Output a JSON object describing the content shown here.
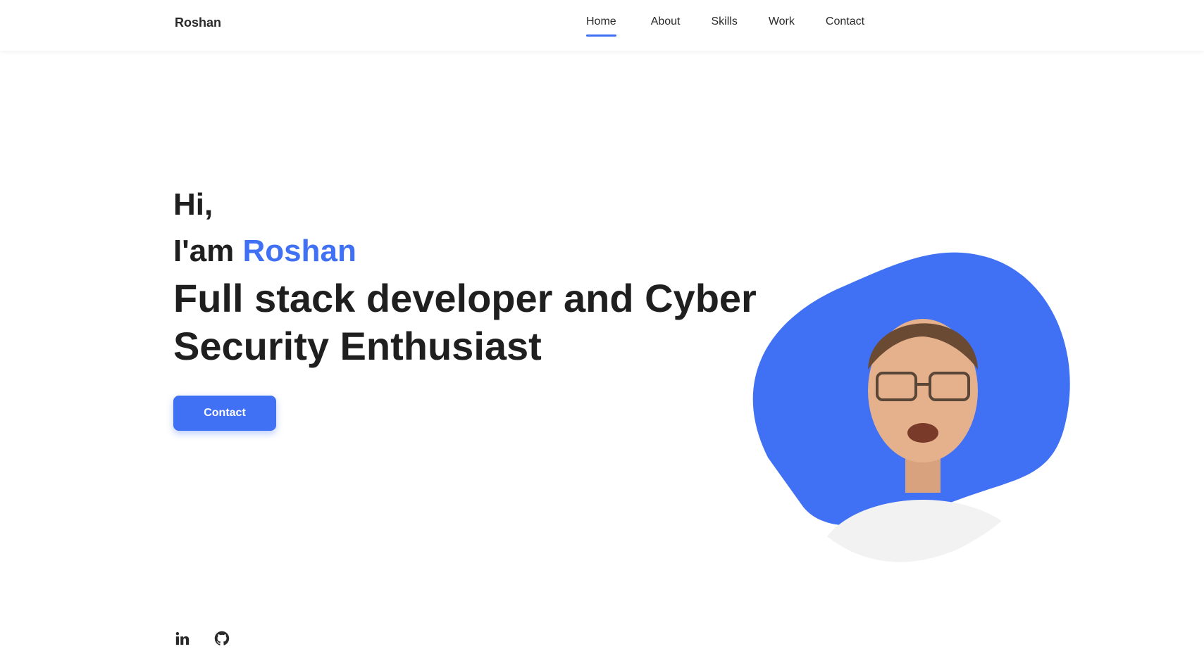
{
  "header": {
    "logo": "Roshan",
    "nav": [
      {
        "label": "Home",
        "active": true
      },
      {
        "label": "About",
        "active": false
      },
      {
        "label": "Skills",
        "active": false
      },
      {
        "label": "Work",
        "active": false
      },
      {
        "label": "Contact",
        "active": false
      }
    ]
  },
  "hero": {
    "greeting": "Hi,",
    "intro_prefix": "I'am ",
    "name": "Roshan",
    "role": "Full stack developer and Cyber Security Enthusiast",
    "cta_label": "Contact"
  },
  "social": [
    {
      "icon": "linkedin-icon"
    },
    {
      "icon": "github-icon"
    }
  ],
  "colors": {
    "accent": "#4070f4",
    "text": "#1f1f1f",
    "background": "#ffffff"
  }
}
